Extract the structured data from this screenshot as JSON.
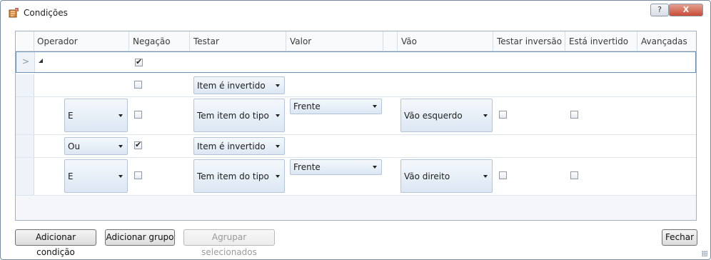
{
  "window": {
    "title": "Condições",
    "help_label": "?",
    "close_label": "X"
  },
  "columns": [
    "Operador",
    "Negação",
    "Testar",
    "Valor",
    "",
    "Vão",
    "Testar inversão",
    "Está invertido",
    "Avançadas"
  ],
  "rows": [
    {
      "negacao": true
    },
    {
      "negacao": false,
      "testar": "Item é invertido"
    },
    {
      "operador": "E",
      "negacao": false,
      "testar": "Tem item do tipo",
      "valor": "Frente",
      "vao": "Vão esquerdo",
      "testar_inversao": false,
      "esta_invertido": false
    },
    {
      "operador": "Ou",
      "negacao": true,
      "testar": "Item é invertido"
    },
    {
      "operador": "E",
      "negacao": false,
      "testar": "Tem item do tipo",
      "valor": "Frente",
      "vao": "Vão direito",
      "testar_inversao": false,
      "esta_invertido": false
    }
  ],
  "buttons": {
    "add_condition": "Adicionar condição",
    "add_group": "Adicionar grupo",
    "group_selected": "Agrupar selecionados",
    "close": "Fechar"
  }
}
